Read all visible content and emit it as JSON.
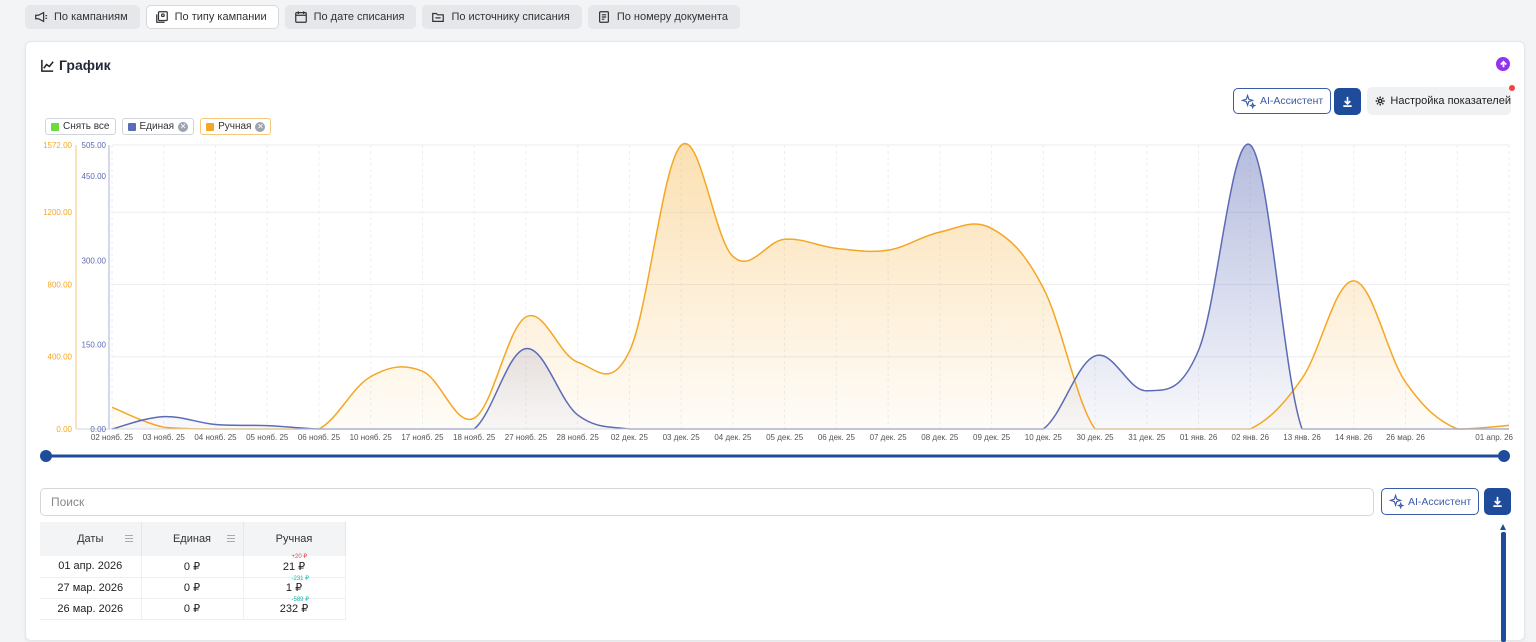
{
  "filters": [
    {
      "label": "По кампаниям",
      "icon": "megaphone-icon",
      "active": false
    },
    {
      "label": "По типу кампании",
      "icon": "campaign-type-icon",
      "active": true
    },
    {
      "label": "По дате списания",
      "icon": "calendar-icon",
      "active": false
    },
    {
      "label": "По источнику списания",
      "icon": "folder-icon",
      "active": false
    },
    {
      "label": "По номеру документа",
      "icon": "document-icon",
      "active": false
    }
  ],
  "card": {
    "title": "График",
    "ai_label": "AI-Ассистент",
    "settings_label": "Настройка показателей",
    "search_placeholder": "Поиск"
  },
  "legend": [
    {
      "label": "Снять все",
      "color": "#6cdc3c",
      "removable": false
    },
    {
      "label": "Единая",
      "color": "#5b6bb5",
      "removable": true
    },
    {
      "label": "Ручная",
      "color": "#f5a623",
      "removable": true
    }
  ],
  "chart_data": {
    "type": "area",
    "x": [
      "02 нояб. 25",
      "03 нояб. 25",
      "04 нояб. 25",
      "05 нояб. 25",
      "06 нояб. 25",
      "10 нояб. 25",
      "17 нояб. 25",
      "18 нояб. 25",
      "27 нояб. 25",
      "28 нояб. 25",
      "02 дек. 25",
      "03 дек. 25",
      "04 дек. 25",
      "05 дек. 25",
      "06 дек. 25",
      "07 дек. 25",
      "08 дек. 25",
      "09 дек. 25",
      "10 дек. 25",
      "30 дек. 25",
      "31 дек. 25",
      "01 янв. 26",
      "02 янв. 26",
      "13 янв. 26",
      "14 янв. 26",
      "26 мар. 26",
      "01 апр. 26"
    ],
    "x_tick_labels": [
      "02 нояб. 25",
      "03 нояб. 25",
      "04 нояб. 25",
      "05 нояб. 25",
      "06 нояб. 25",
      "10 нояб. 25",
      "17 нояб. 25",
      "18 нояб. 25",
      "27 нояб. 25",
      "28 нояб. 25",
      "02 дек. 25",
      "03 дек. 25",
      "04 дек. 25",
      "05 дек. 25",
      "06 дек. 25",
      "07 дек. 25",
      "08 дек. 25",
      "09 дек. 25",
      "10 дек. 25",
      "30 дек. 25",
      "31 дек. 25",
      "01 янв. 26",
      "02 янв. 26",
      "13 янв. 26",
      "14 янв. 26",
      "26 мар. 26",
      "",
      "01 апр. 26"
    ],
    "series": [
      {
        "name": "Ручная",
        "axis": "left",
        "color": "#f5a623",
        "values": [
          120,
          10,
          0,
          0,
          0,
          290,
          320,
          60,
          620,
          370,
          430,
          1570,
          955,
          1050,
          1000,
          990,
          1090,
          1110,
          780,
          0,
          0,
          0,
          0,
          280,
          820,
          260,
          0,
          20
        ]
      },
      {
        "name": "Единая",
        "axis": "right",
        "color": "#5b6bb5",
        "values": [
          0,
          22,
          8,
          6,
          0,
          0,
          0,
          0,
          143,
          25,
          0,
          0,
          0,
          0,
          0,
          0,
          0,
          0,
          0,
          130,
          68,
          140,
          505,
          0,
          0,
          0,
          0,
          0
        ]
      }
    ],
    "left_axis": {
      "ticks": [
        "0.00",
        "400.00",
        "800.00",
        "1200.00",
        "1572.00"
      ],
      "values": [
        0,
        400,
        800,
        1200,
        1572
      ],
      "color": "#f5a623"
    },
    "right_axis": {
      "ticks": [
        "0.00",
        "150.00",
        "300.00",
        "450.00",
        "505.00"
      ],
      "values": [
        0,
        150,
        300,
        450,
        505
      ],
      "color": "#5b6bb5"
    },
    "grid": true
  },
  "table": {
    "columns": [
      "Даты",
      "Единая",
      "Ручная"
    ],
    "rows": [
      {
        "date": "01 апр. 2026",
        "edinaya": "0 ₽",
        "ruchnaya": "21 ₽",
        "delta": "+20 ₽",
        "delta_color": "#ef4444"
      },
      {
        "date": "27 мар. 2026",
        "edinaya": "0 ₽",
        "ruchnaya": "1 ₽",
        "delta": "-231 ₽",
        "delta_color": "#14b8a6"
      },
      {
        "date": "26 мар. 2026",
        "edinaya": "0 ₽",
        "ruchnaya": "232 ₽",
        "delta": "-589 ₽",
        "delta_color": "#14b8a6"
      }
    ]
  }
}
